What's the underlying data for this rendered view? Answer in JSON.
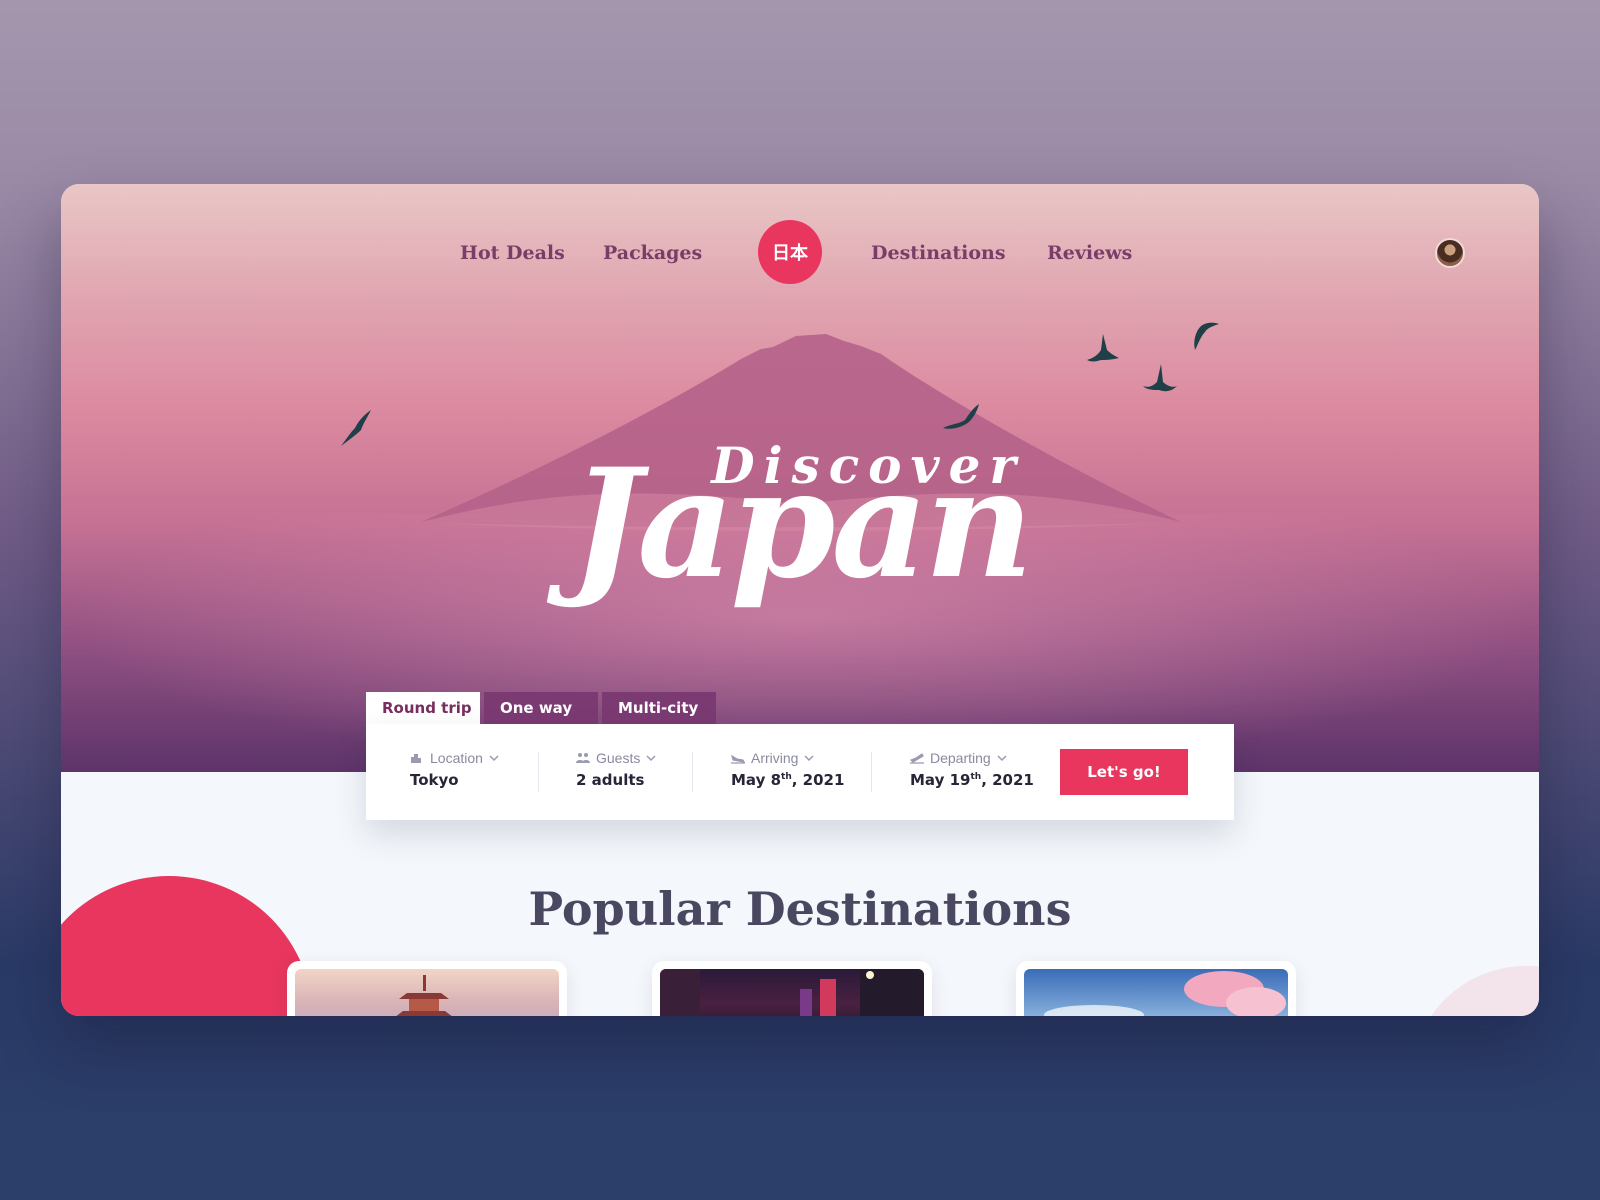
{
  "nav": {
    "links": [
      "Hot Deals",
      "Packages",
      "Destinations",
      "Reviews"
    ],
    "logo_text": "日本"
  },
  "hero": {
    "title_small": "Discover",
    "title_large": "Japan"
  },
  "trip_tabs": [
    {
      "label": "Round trip",
      "active": true
    },
    {
      "label": "One way",
      "active": false
    },
    {
      "label": "Multi-city",
      "active": false
    }
  ],
  "search": {
    "location": {
      "label": "Location",
      "value": "Tokyo",
      "icon": "city-icon"
    },
    "guests": {
      "label": "Guests",
      "value": "2 adults",
      "icon": "people-icon"
    },
    "arriving": {
      "label": "Arriving",
      "value_month_day": "May 8",
      "value_suffix": "th",
      "value_year": ", 2021",
      "icon": "plane-landing-icon"
    },
    "departing": {
      "label": "Departing",
      "value_month_day": "May 19",
      "value_suffix": "th",
      "value_year": ", 2021",
      "icon": "plane-takeoff-icon"
    },
    "submit_label": "Let's go!"
  },
  "popular": {
    "title": "Popular Destinations",
    "cards": [
      {
        "image": "pagoda-image"
      },
      {
        "image": "neon-street-image"
      },
      {
        "image": "cherry-blossom-image"
      }
    ]
  },
  "colors": {
    "accent": "#e8365e",
    "nav_text": "#7a3d68",
    "tab_bg": "#7b3a72",
    "heading": "#4a4860"
  }
}
